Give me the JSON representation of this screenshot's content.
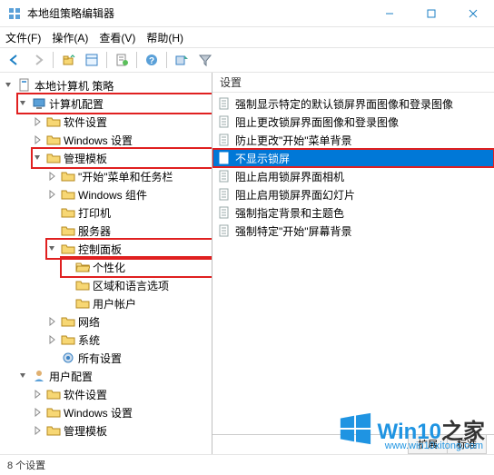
{
  "titlebar": {
    "title": "本地组策略编辑器"
  },
  "menubar": {
    "file": "文件(F)",
    "action": "操作(A)",
    "view": "查看(V)",
    "help": "帮助(H)"
  },
  "tree": {
    "root": "本地计算机 策略",
    "comp_config": "计算机配置",
    "soft_settings": "软件设置",
    "win_settings": "Windows 设置",
    "admin_templates": "管理模板",
    "start_taskbar": "\"开始\"菜单和任务栏",
    "win_components": "Windows 组件",
    "printer": "打印机",
    "server": "服务器",
    "control_panel": "控制面板",
    "personalization": "个性化",
    "region_lang": "区域和语言选项",
    "user_accounts": "用户帐户",
    "network": "网络",
    "system": "系统",
    "all_settings": "所有设置",
    "user_config": "用户配置",
    "u_soft_settings": "软件设置",
    "u_win_settings": "Windows 设置",
    "u_admin_templates": "管理模板"
  },
  "listhead": "设置",
  "list": [
    "强制显示特定的默认锁屏界面图像和登录图像",
    "阻止更改锁屏界面图像和登录图像",
    "防止更改\"开始\"菜单背景",
    "不显示锁屏",
    "阻止启用锁屏界面相机",
    "阻止启用锁屏界面幻灯片",
    "强制指定背景和主题色",
    "强制特定\"开始\"屏幕背景"
  ],
  "selected_index": 3,
  "tabs": {
    "ext": "扩展",
    "std": "标准"
  },
  "status": "8 个设置",
  "watermark": {
    "brand": "Win10",
    "suffix": "之家",
    "url": "www.win10xitong.com"
  }
}
